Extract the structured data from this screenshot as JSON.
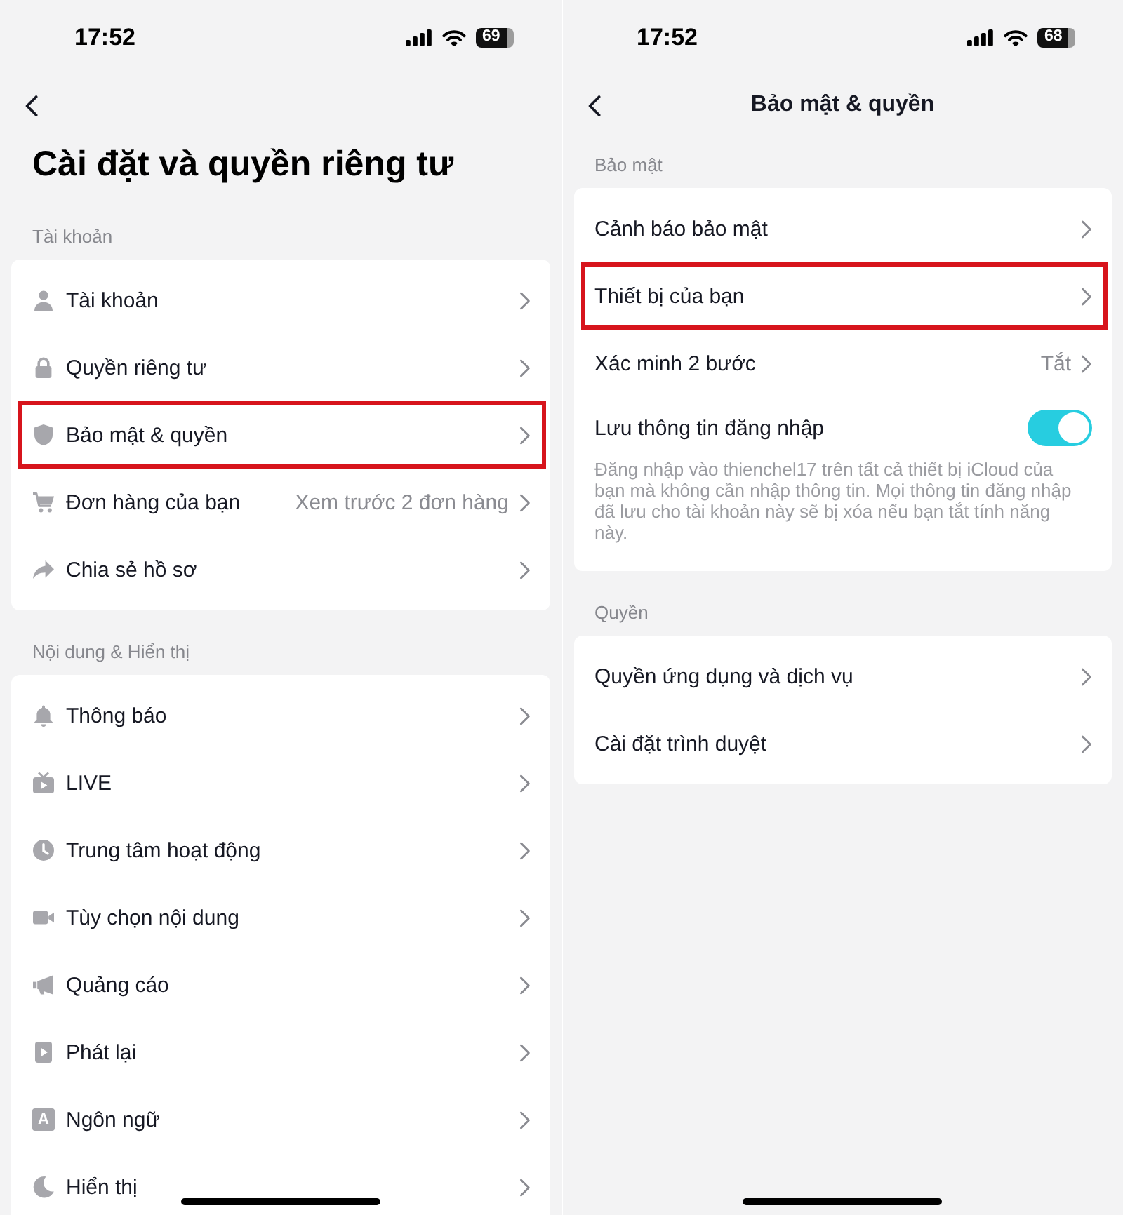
{
  "screens": [
    {
      "status_bar": {
        "time": "17:52",
        "battery": "69"
      },
      "page_title": "Cài đặt và quyền riêng tư",
      "sections": [
        {
          "header": "Tài khoản",
          "rows": [
            {
              "kind": "link",
              "label": "Tài khoản",
              "highlighted": false
            },
            {
              "kind": "link",
              "label": "Quyền riêng tư",
              "highlighted": false
            },
            {
              "kind": "link",
              "label": "Bảo mật & quyền",
              "highlighted": true
            },
            {
              "kind": "link",
              "label": "Đơn hàng của bạn",
              "value": "Xem trước 2 đơn hàng",
              "highlighted": false
            },
            {
              "kind": "link",
              "label": "Chia sẻ hồ sơ",
              "highlighted": false
            }
          ]
        },
        {
          "header": "Nội dung & Hiển thị",
          "rows": [
            {
              "kind": "link",
              "label": "Thông báo",
              "highlighted": false
            },
            {
              "kind": "link",
              "label": "LIVE",
              "highlighted": false
            },
            {
              "kind": "link",
              "label": "Trung tâm hoạt động",
              "highlighted": false
            },
            {
              "kind": "link",
              "label": "Tùy chọn nội dung",
              "highlighted": false
            },
            {
              "kind": "link",
              "label": "Quảng cáo",
              "highlighted": false
            },
            {
              "kind": "link",
              "label": "Phát lại",
              "highlighted": false
            },
            {
              "kind": "link",
              "label": "Ngôn ngữ",
              "icon_glyph": "A",
              "highlighted": false
            },
            {
              "kind": "link",
              "label": "Hiển thị",
              "highlighted": false
            }
          ]
        }
      ]
    },
    {
      "status_bar": {
        "time": "17:52",
        "battery": "68"
      },
      "nav_title": "Bảo mật & quyền",
      "sections": [
        {
          "header": "Bảo mật",
          "rows": [
            {
              "kind": "link",
              "label": "Cảnh báo bảo mật",
              "highlighted": false
            },
            {
              "kind": "link",
              "label": "Thiết bị của bạn",
              "highlighted": true
            },
            {
              "kind": "link",
              "label": "Xác minh 2 bước",
              "value": "Tắt",
              "highlighted": false
            },
            {
              "kind": "toggle",
              "label": "Lưu thông tin đăng nhập",
              "on": true,
              "description": "Đăng nhập vào thienchel17 trên tất cả thiết bị iCloud của bạn mà không cần nhập thông tin. Mọi thông tin đăng nhập đã lưu cho tài khoản này sẽ bị xóa nếu bạn tắt tính năng này."
            }
          ]
        },
        {
          "header": "Quyền",
          "rows": [
            {
              "kind": "link",
              "label": "Quyền ứng dụng và dịch vụ",
              "highlighted": false
            },
            {
              "kind": "link",
              "label": "Cài đặt trình duyệt",
              "highlighted": false
            }
          ]
        }
      ]
    }
  ]
}
